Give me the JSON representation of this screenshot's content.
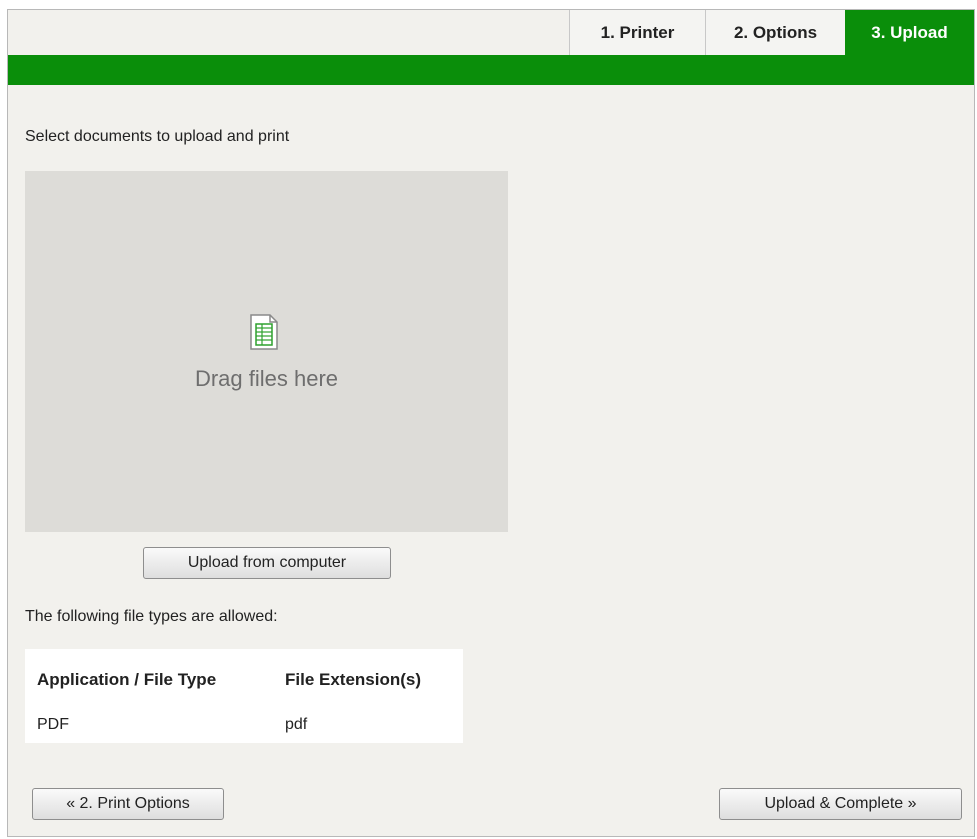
{
  "steps": {
    "printer": "1. Printer",
    "options": "2. Options",
    "upload": "3. Upload",
    "active_color": "#0a8e0a"
  },
  "upload": {
    "intro": "Select documents to upload and print",
    "drop_text": "Drag files here",
    "drop_icon": "document-icon",
    "upload_button": "Upload from computer"
  },
  "file_types": {
    "intro": "The following file types are allowed:",
    "headers": [
      "Application / File Type",
      "File Extension(s)"
    ],
    "rows": [
      [
        "PDF",
        "pdf"
      ]
    ]
  },
  "nav": {
    "back": "« 2. Print Options",
    "next": "Upload & Complete »"
  }
}
